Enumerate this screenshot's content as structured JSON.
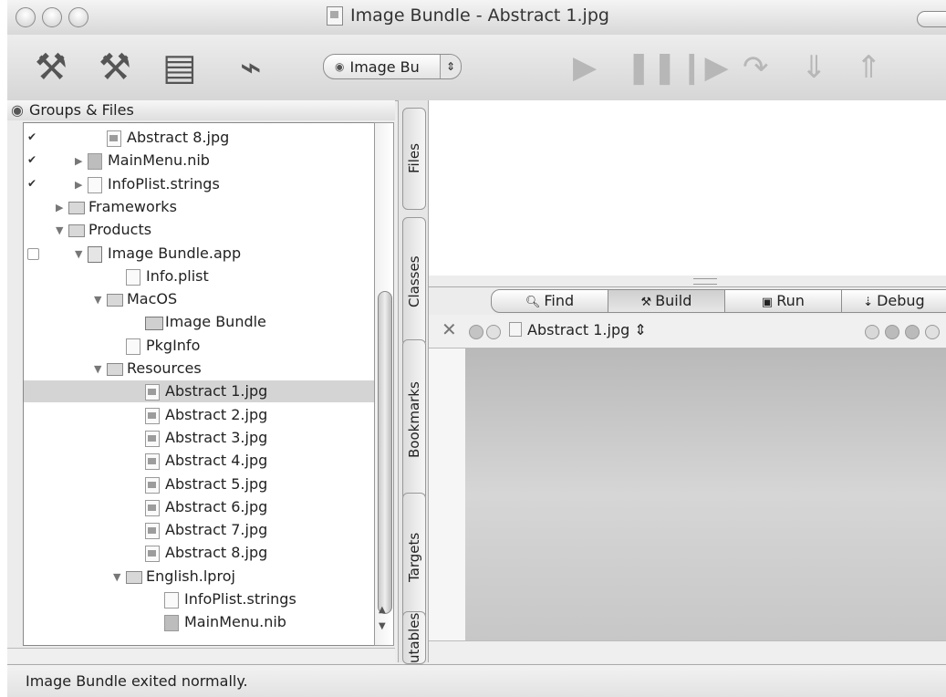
{
  "window": {
    "title": "Image Bundle - Abstract 1.jpg"
  },
  "toolbar": {
    "tools": [
      "build-hammer-icon",
      "build-and-go-icon",
      "clean-icon",
      "broom-icon"
    ],
    "target_select": "Image Bu",
    "debug_buttons": [
      "play-icon",
      "pause-icon",
      "step-icon",
      "step-over-icon",
      "step-into-icon",
      "step-out-icon"
    ]
  },
  "groups": {
    "header": "Groups & Files",
    "rows": [
      {
        "label": "Abstract 8.jpg",
        "check": "check",
        "indent": 5,
        "icon": "img",
        "tri": ""
      },
      {
        "label": "MainMenu.nib",
        "check": "check",
        "indent": 4,
        "icon": "nib",
        "tri": "▶"
      },
      {
        "label": "InfoPlist.strings",
        "check": "check",
        "indent": 4,
        "icon": "doc",
        "tri": "▶"
      },
      {
        "label": "Frameworks",
        "check": "",
        "indent": 3,
        "icon": "folder",
        "tri": "▶"
      },
      {
        "label": "Products",
        "check": "",
        "indent": 3,
        "icon": "folder",
        "tri": "▼"
      },
      {
        "label": "Image Bundle.app",
        "check": "empty",
        "indent": 4,
        "icon": "app",
        "tri": "▼"
      },
      {
        "label": "Info.plist",
        "check": "",
        "indent": 6,
        "icon": "doc",
        "tri": ""
      },
      {
        "label": "MacOS",
        "check": "",
        "indent": 5,
        "icon": "folder",
        "tri": "▼"
      },
      {
        "label": "Image Bundle",
        "check": "",
        "indent": 7,
        "icon": "exe",
        "tri": ""
      },
      {
        "label": "PkgInfo",
        "check": "",
        "indent": 6,
        "icon": "doc",
        "tri": ""
      },
      {
        "label": "Resources",
        "check": "",
        "indent": 5,
        "icon": "folder",
        "tri": "▼"
      },
      {
        "label": "Abstract 1.jpg",
        "check": "",
        "indent": 7,
        "icon": "img",
        "tri": "",
        "selected": true
      },
      {
        "label": "Abstract 2.jpg",
        "check": "",
        "indent": 7,
        "icon": "img",
        "tri": ""
      },
      {
        "label": "Abstract 3.jpg",
        "check": "",
        "indent": 7,
        "icon": "img",
        "tri": ""
      },
      {
        "label": "Abstract 4.jpg",
        "check": "",
        "indent": 7,
        "icon": "img",
        "tri": ""
      },
      {
        "label": "Abstract 5.jpg",
        "check": "",
        "indent": 7,
        "icon": "img",
        "tri": ""
      },
      {
        "label": "Abstract 6.jpg",
        "check": "",
        "indent": 7,
        "icon": "img",
        "tri": ""
      },
      {
        "label": "Abstract 7.jpg",
        "check": "",
        "indent": 7,
        "icon": "img",
        "tri": ""
      },
      {
        "label": "Abstract 8.jpg",
        "check": "",
        "indent": 7,
        "icon": "img",
        "tri": ""
      },
      {
        "label": "English.lproj",
        "check": "",
        "indent": 6,
        "icon": "folder",
        "tri": "▼"
      },
      {
        "label": "InfoPlist.strings",
        "check": "",
        "indent": 8,
        "icon": "doc",
        "tri": ""
      },
      {
        "label": "MainMenu.nib",
        "check": "",
        "indent": 8,
        "icon": "nib",
        "tri": ""
      }
    ]
  },
  "vtabs": [
    {
      "label": "Files",
      "icon": "doc-icon"
    },
    {
      "label": "Classes",
      "icon": "class-icon"
    },
    {
      "label": "Bookmarks",
      "icon": "bookmark-icon"
    },
    {
      "label": "Targets",
      "icon": "target-icon"
    },
    {
      "label": "utables",
      "icon": ""
    }
  ],
  "segments": [
    {
      "label": "Find",
      "glyph": "🔍︎"
    },
    {
      "label": "Build",
      "glyph": "⚒"
    },
    {
      "label": "Run",
      "glyph": "▣"
    },
    {
      "label": "Debug",
      "glyph": "⇣"
    }
  ],
  "editor": {
    "file_popup": "Abstract 1.jpg ⇕"
  },
  "status": "Image Bundle exited normally."
}
